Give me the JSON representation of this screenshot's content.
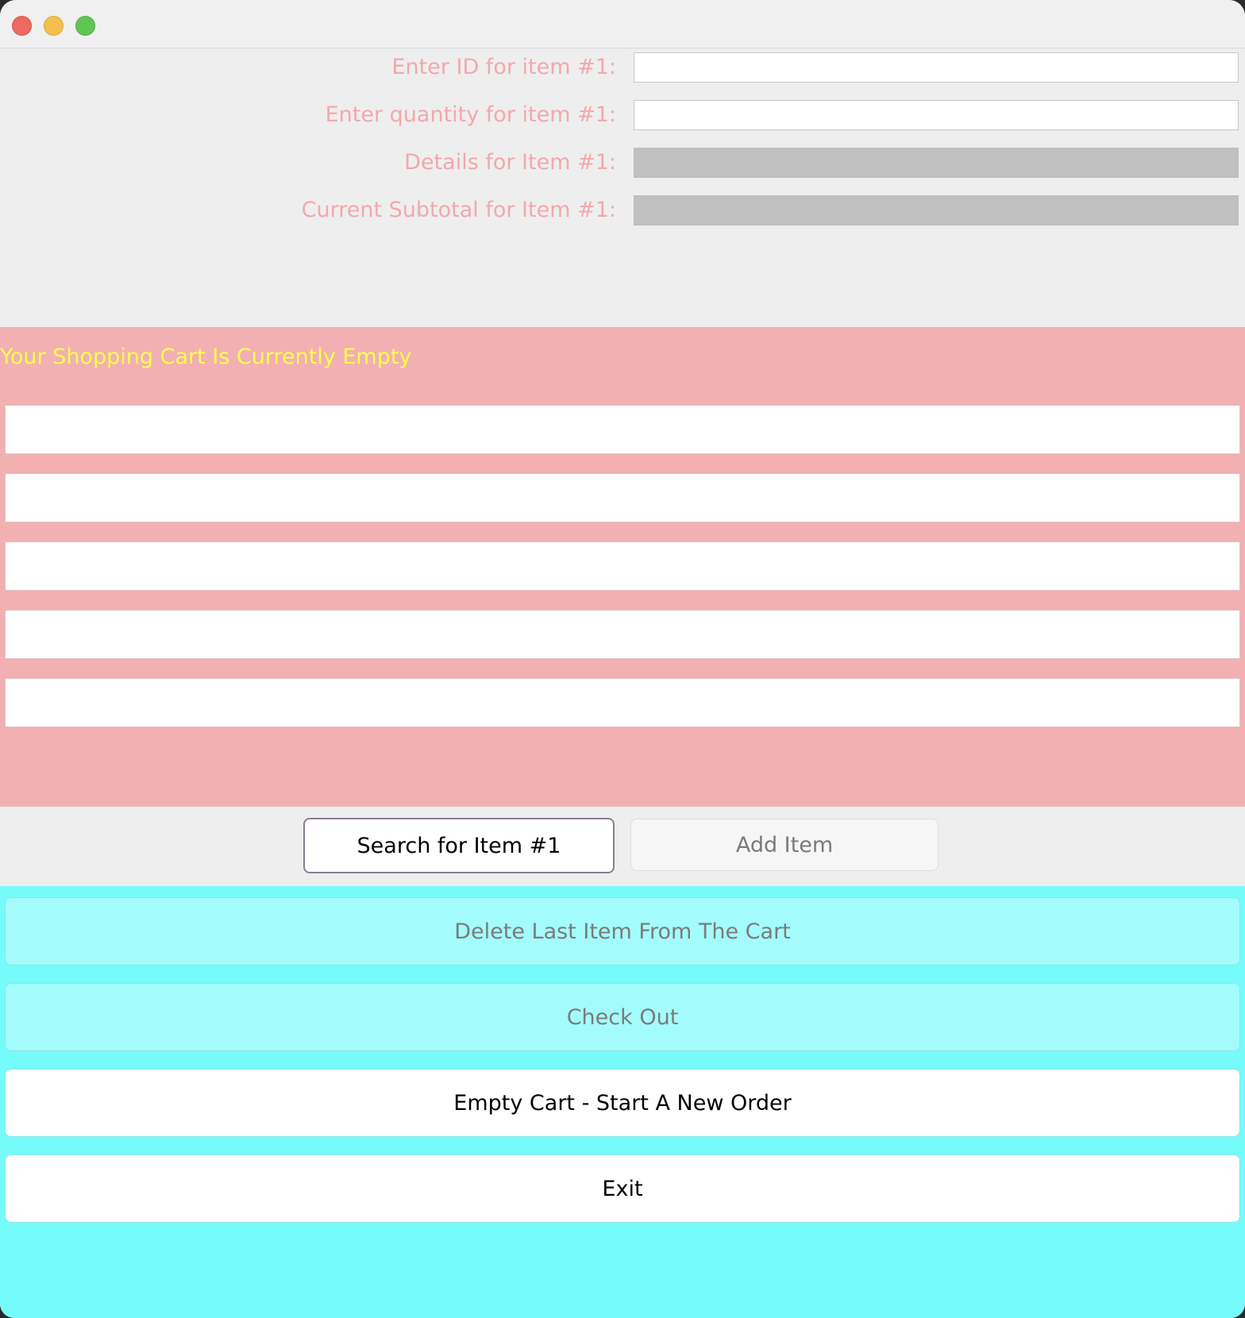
{
  "window": {
    "controls": [
      "close",
      "minimize",
      "maximize"
    ]
  },
  "form": {
    "id_label": "Enter ID for item #1:",
    "id_value": "",
    "quantity_label": "Enter quantity for item #1:",
    "quantity_value": "",
    "details_label": "Details for Item #1:",
    "details_value": "",
    "subtotal_label": "Current Subtotal for Item #1:",
    "subtotal_value": ""
  },
  "cart": {
    "title": "Your Shopping Cart Is Currently Empty",
    "lines": [
      "",
      "",
      "",
      "",
      ""
    ]
  },
  "actions": {
    "search_label": "Search for Item #1",
    "add_label": "Add Item",
    "delete_label": "Delete Last Item From The Cart",
    "checkout_label": "Check Out",
    "empty_label": "Empty Cart - Start A New Order",
    "exit_label": "Exit"
  },
  "colors": {
    "form_label": "#f2a8ac",
    "cart_background": "#f2b0b3",
    "cart_title": "#ffff4d",
    "bottom_background": "#76fbfb",
    "disabled_button": "#a3fcfb",
    "readonly_field": "#c0c0c0"
  }
}
